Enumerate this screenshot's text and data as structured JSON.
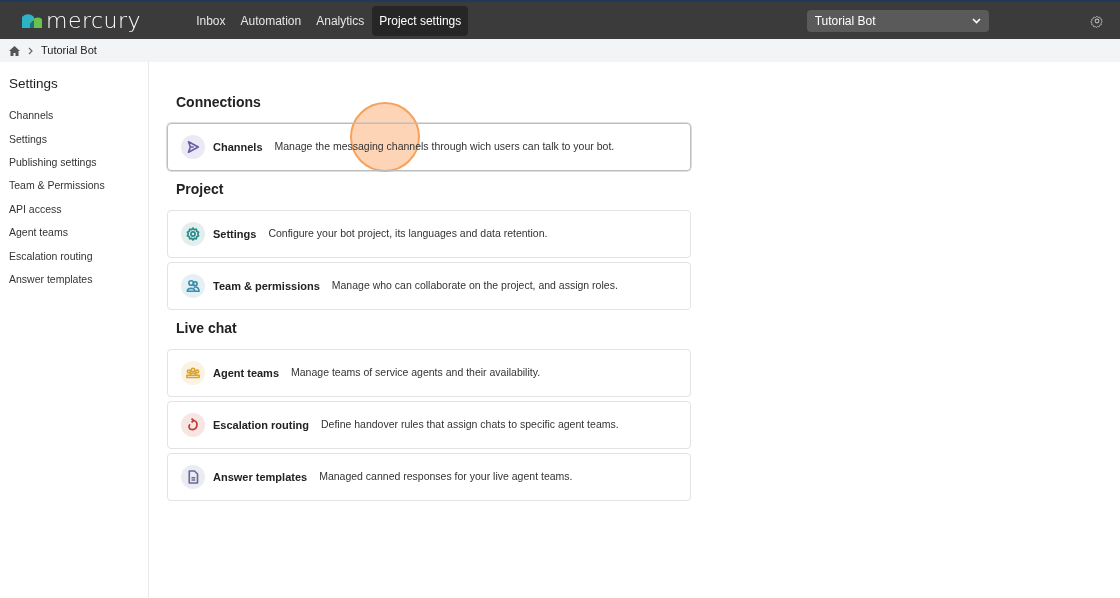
{
  "header": {
    "logo": "mercury",
    "nav": [
      {
        "label": "Inbox",
        "selected": false
      },
      {
        "label": "Automation",
        "selected": false
      },
      {
        "label": "Analytics",
        "selected": false
      },
      {
        "label": "Project settings",
        "selected": true
      }
    ],
    "project_select": {
      "value": "Tutorial Bot"
    }
  },
  "breadcrumb": [
    "Tutorial Bot"
  ],
  "sidebar": {
    "title": "Settings",
    "items": [
      "Channels",
      "Settings",
      "Publishing settings",
      "Team & Permissions",
      "API access",
      "Agent teams",
      "Escalation routing",
      "Answer templates"
    ]
  },
  "sections": [
    {
      "title": "Connections",
      "cards": [
        {
          "kind": "send",
          "color": "#6b5ca5",
          "title": "Channels",
          "description": "Manage the messaging channels through wich users can talk to your bot.",
          "hovered": true,
          "click_marker": true
        }
      ]
    },
    {
      "title": "Project",
      "cards": [
        {
          "kind": "gear",
          "color": "#2a8a8a",
          "title": "Settings",
          "description": "Configure your bot project, its languages and data retention.",
          "hovered": false,
          "click_marker": false
        },
        {
          "kind": "people",
          "color": "#3a8fb0",
          "title": "Team & permissions",
          "description": "Manage who can collaborate on the project, and assign roles.",
          "hovered": false,
          "click_marker": false
        }
      ]
    },
    {
      "title": "Live chat",
      "cards": [
        {
          "kind": "group",
          "color": "#dba32c",
          "title": "Agent teams",
          "description": "Manage teams of service agents and their availability.",
          "hovered": false,
          "click_marker": false
        },
        {
          "kind": "escalate",
          "color": "#c0392b",
          "title": "Escalation routing",
          "description": "Define handover rules that assign chats to specific agent teams.",
          "hovered": false,
          "click_marker": false
        },
        {
          "kind": "document",
          "color": "#6a6a9a",
          "title": "Answer templates",
          "description": "Managed canned responses for your live agent teams.",
          "hovered": false,
          "click_marker": false
        }
      ]
    }
  ]
}
